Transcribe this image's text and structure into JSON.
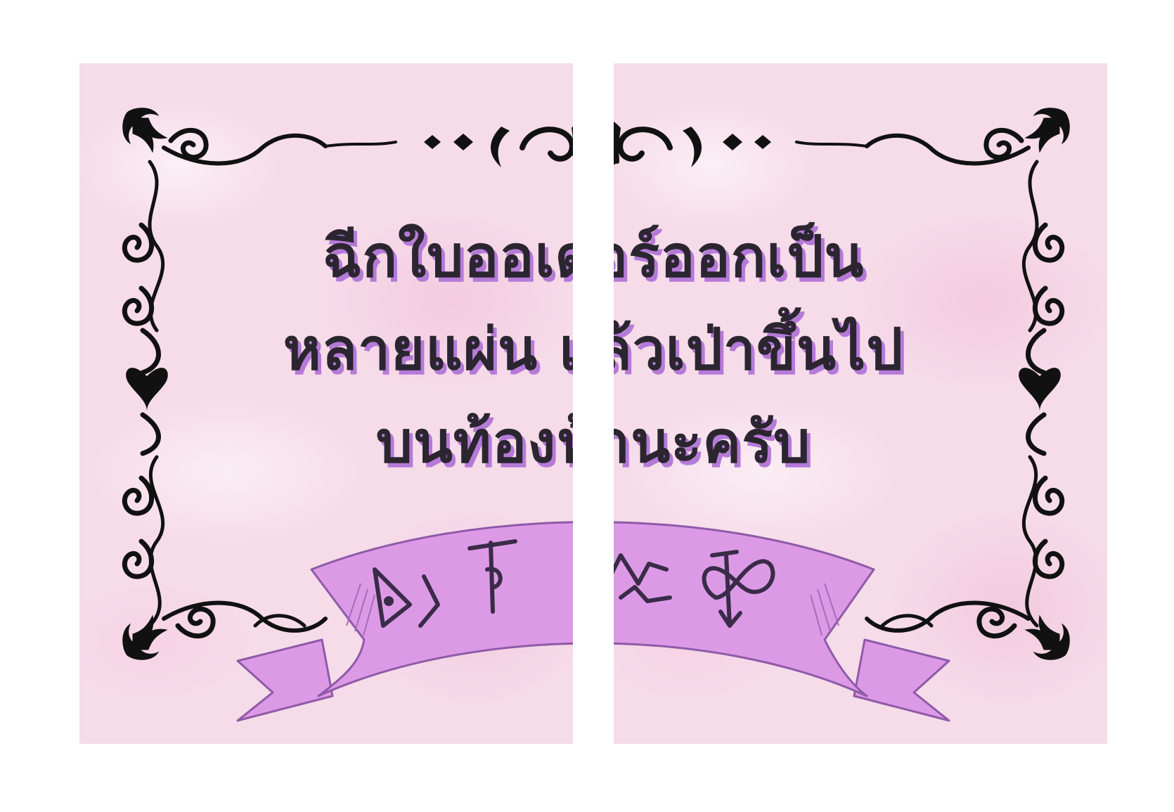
{
  "card": {
    "message_lines": [
      "ฉีกใบออเดอร์ออกเป็น",
      "หลายแผ่น แล้วเป่าขึ้นไป",
      "บนท้องฟ้านะครับ"
    ]
  },
  "colors": {
    "card_background": "#f6dbe9",
    "text": "#2b2530",
    "text_shadow": "#b57ad8",
    "ribbon": "#dc9ae6",
    "ribbon_stroke": "#8e5aa8",
    "frame": "#111111"
  },
  "icons": [
    "ornate-frame",
    "ribbon-banner",
    "rune-symbols"
  ]
}
